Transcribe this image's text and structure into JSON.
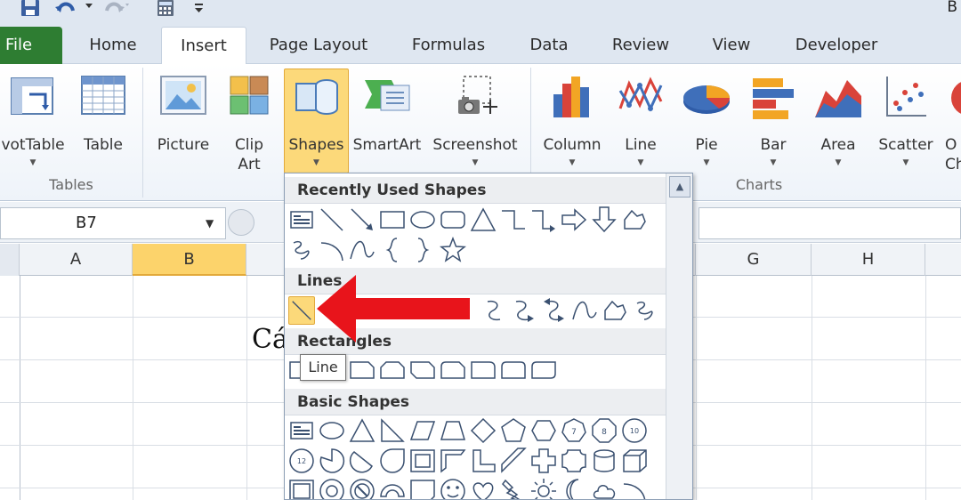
{
  "window": {
    "title": "B"
  },
  "tabs": [
    {
      "label": "File",
      "name": "tab-file"
    },
    {
      "label": "Home",
      "name": "tab-home"
    },
    {
      "label": "Insert",
      "name": "tab-insert"
    },
    {
      "label": "Page Layout",
      "name": "tab-page-layout"
    },
    {
      "label": "Formulas",
      "name": "tab-formulas"
    },
    {
      "label": "Data",
      "name": "tab-data"
    },
    {
      "label": "Review",
      "name": "tab-review"
    },
    {
      "label": "View",
      "name": "tab-view"
    },
    {
      "label": "Developer",
      "name": "tab-developer"
    }
  ],
  "ribbon": {
    "tables_group": "Tables",
    "charts_group": "Charts",
    "buttons": {
      "pivottable": "votTable",
      "table": "Table",
      "picture": "Picture",
      "clipart": "Clip Art",
      "shapes": "Shapes",
      "smartart": "SmartArt",
      "screenshot": "Screenshot",
      "column": "Column",
      "line": "Line",
      "pie": "Pie",
      "bar": "Bar",
      "area": "Area",
      "scatter": "Scatter",
      "other": "O Ch"
    }
  },
  "formula_bar": {
    "cell_ref": "B7"
  },
  "grid": {
    "columns": [
      "A",
      "B",
      "G",
      "H"
    ],
    "cell_text": "Cá"
  },
  "shapes_menu": {
    "sections": [
      "Recently Used Shapes",
      "Lines",
      "Rectangles",
      "Basic Shapes"
    ],
    "tooltip": "Line"
  },
  "colors": {
    "file_tab": "#2e7d32",
    "selection": "#fcd97a",
    "arrow": "#e8141b"
  }
}
